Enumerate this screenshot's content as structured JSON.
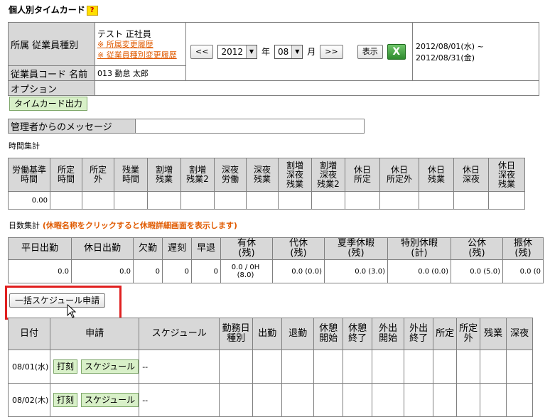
{
  "page": {
    "title": "個人別タイムカード",
    "help_badge": "?"
  },
  "header": {
    "dept_label": "所属 従業員種別",
    "dept_value": "テスト 正社員",
    "dept_history_link": "※ 所属変更履歴",
    "type_history_link": "※ 従業員種別変更履歴",
    "emp_label": "従業員コード 名前",
    "emp_value": "013 勤怠 太郎",
    "option_label": "オプション",
    "prev_button": "<<",
    "year_value": "2012",
    "year_unit": "年",
    "month_value": "08",
    "month_unit": "月",
    "next_button": ">>",
    "show_button": "表示",
    "excel_icon": "excel-icon",
    "period": "2012/08/01(水) ~ 2012/08/31(金)"
  },
  "timecard_button": "タイムカード出力",
  "message": {
    "label": "管理者からのメッセージ",
    "value": ""
  },
  "time_summary": {
    "title": "時間集計",
    "headers": [
      "労働基準\n時間",
      "所定\n時間",
      "所定\n外",
      "残業\n時間",
      "割増\n残業",
      "割増\n残業2",
      "深夜\n労働",
      "深夜\n残業",
      "割増\n深夜\n残業",
      "割増\n深夜\n残業2",
      "休日\n所定",
      "休日\n所定外",
      "休日\n残業",
      "休日\n深夜",
      "休日\n深夜\n残業"
    ],
    "values": [
      "0.00",
      "",
      "",
      "",
      "",
      "",
      "",
      "",
      "",
      "",
      "",
      "",
      "",
      "",
      ""
    ]
  },
  "day_summary": {
    "title": "日数集計",
    "note": "(休暇名称をクリックすると休暇詳細画面を表示します)",
    "headers": [
      "平日出勤",
      "休日出勤",
      "欠勤",
      "遅刻",
      "早退",
      "有休\n(残)",
      "代休\n(残)",
      "夏季休暇\n(残)",
      "特別休暇\n(計)",
      "公休\n(残)",
      "振休\n(残)"
    ],
    "values": [
      "0.0",
      "0.0",
      "0",
      "0",
      "0",
      "0.0 / 0H\n(8.0)",
      "0.0 (0.0)",
      "0.0 (3.0)",
      "0.0 (0.0)",
      "0.0 (5.0)",
      "0.0 (0"
    ]
  },
  "bulk_button": "一括スケジュール申請",
  "schedule": {
    "headers": [
      "日付",
      "申請",
      "スケジュール",
      "勤務日\n種別",
      "出勤",
      "退勤",
      "休憩\n開始",
      "休憩\n終了",
      "外出\n開始",
      "外出\n終了",
      "所定",
      "所定\n外",
      "残業",
      "深夜"
    ],
    "rows": [
      {
        "date": "08/01(水)",
        "stamp": "打刻",
        "schedule_btn": "スケジュール",
        "schedule": "--"
      },
      {
        "date": "08/02(木)",
        "stamp": "打刻",
        "schedule_btn": "スケジュール",
        "schedule": "--"
      }
    ]
  }
}
